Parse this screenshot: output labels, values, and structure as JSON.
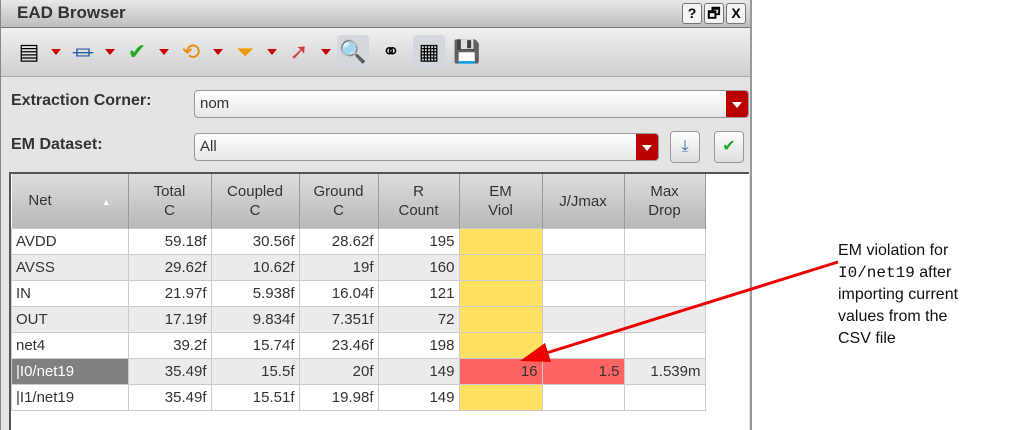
{
  "window": {
    "title": "EAD Browser",
    "buttons": [
      "?",
      "🗗",
      "X"
    ]
  },
  "toolbar": {
    "icons": [
      "properties-icon",
      "parasitic-icon",
      "check-icon",
      "reset-icon",
      "filter-icon",
      "probe-icon",
      "zoom-icon",
      "binoculars-icon",
      "table-view-icon",
      "save-icon"
    ]
  },
  "extraction": {
    "label": "Extraction Corner:",
    "value": "nom"
  },
  "dataset": {
    "label": "EM Dataset:",
    "value": "All"
  },
  "table": {
    "headers": [
      [
        "Net",
        ""
      ],
      [
        "Total",
        "C"
      ],
      [
        "Coupled",
        "C"
      ],
      [
        "Ground",
        "C"
      ],
      [
        "R",
        "Count"
      ],
      [
        "EM",
        "Viol"
      ],
      [
        "J/Jmax",
        ""
      ],
      [
        "Max",
        "Drop"
      ]
    ],
    "rows": [
      [
        "AVDD",
        "59.18f",
        "30.56f",
        "28.62f",
        "195",
        "",
        "",
        ""
      ],
      [
        "AVSS",
        "29.62f",
        "10.62f",
        "19f",
        "160",
        "",
        "",
        ""
      ],
      [
        "IN",
        "21.97f",
        "5.938f",
        "16.04f",
        "121",
        "",
        "",
        ""
      ],
      [
        "OUT",
        "17.19f",
        "9.834f",
        "7.351f",
        "72",
        "",
        "",
        ""
      ],
      [
        "net4",
        "39.2f",
        "15.74f",
        "23.46f",
        "198",
        "",
        "",
        ""
      ],
      [
        "|I0/net19",
        "35.49f",
        "15.5f",
        "20f",
        "149",
        "16",
        "1.5",
        "1.539m"
      ],
      [
        "|I1/net19",
        "35.49f",
        "15.51f",
        "19.98f",
        "149",
        "",
        "",
        ""
      ]
    ]
  },
  "annotation": {
    "line1": "EM violation for",
    "code": "I0/net19",
    "line2": " after",
    "line3": "importing current",
    "line4": "values from the",
    "line5": "CSV file"
  }
}
